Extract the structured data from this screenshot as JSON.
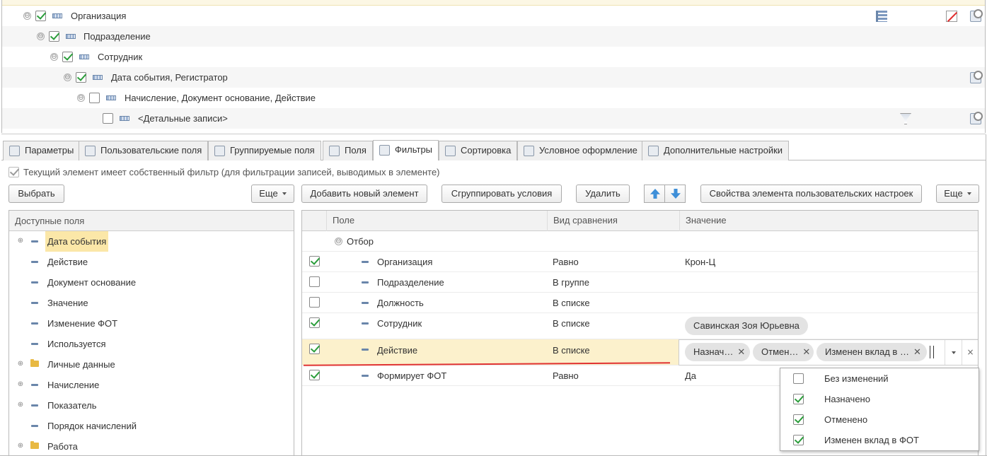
{
  "tree": {
    "rows": [
      {
        "label": "Организация",
        "checked": true
      },
      {
        "label": "Подразделение",
        "checked": true
      },
      {
        "label": "Сотрудник",
        "checked": true
      },
      {
        "label": "Дата события, Регистратор",
        "checked": true
      },
      {
        "label": "Начисление, Документ основание, Действие",
        "checked": false
      },
      {
        "label": "<Детальные записи>",
        "checked": false
      }
    ]
  },
  "tabs": [
    {
      "label": "Параметры"
    },
    {
      "label": "Пользовательские поля"
    },
    {
      "label": "Группируемые поля"
    },
    {
      "label": "Поля"
    },
    {
      "label": "Фильтры"
    },
    {
      "label": "Сортировка"
    },
    {
      "label": "Условное оформление"
    },
    {
      "label": "Дополнительные настройки"
    }
  ],
  "own_filter": {
    "label": "Текущий элемент имеет собственный фильтр (для фильтрации записей, выводимых в элементе)",
    "checked": true
  },
  "left_toolbar": {
    "select": "Выбрать",
    "more": "Еще"
  },
  "right_toolbar": {
    "add": "Добавить новый элемент",
    "group": "Сгруппировать условия",
    "delete": "Удалить",
    "properties": "Свойства элемента пользовательских настроек",
    "more": "Еще"
  },
  "available_fields": {
    "header": "Доступные поля",
    "items": [
      {
        "label": "Дата события"
      },
      {
        "label": "Действие"
      },
      {
        "label": "Документ основание"
      },
      {
        "label": "Значение"
      },
      {
        "label": "Изменение ФОТ"
      },
      {
        "label": "Используется"
      },
      {
        "label": "Личные данные"
      },
      {
        "label": "Начисление"
      },
      {
        "label": "Показатель"
      },
      {
        "label": "Порядок начислений"
      },
      {
        "label": "Работа"
      }
    ]
  },
  "filter_grid": {
    "headers": {
      "field": "Поле",
      "comparison": "Вид сравнения",
      "value": "Значение"
    },
    "group_label": "Отбор",
    "rows": [
      {
        "field": "Организация",
        "comparison": "Равно",
        "value": "Крон-Ц",
        "checked": true
      },
      {
        "field": "Подразделение",
        "comparison": "В группе",
        "value": "",
        "checked": false
      },
      {
        "field": "Должность",
        "comparison": "В списке",
        "value": "",
        "checked": false
      },
      {
        "field": "Сотрудник",
        "comparison": "В списке",
        "chip": "Савинская Зоя Юрьевна",
        "checked": true
      },
      {
        "field": "Действие",
        "comparison": "В списке",
        "checked": true
      },
      {
        "field": "Формирует ФОТ",
        "comparison": "Равно",
        "value": "Да",
        "checked": true
      }
    ],
    "editor_chips": [
      {
        "label": "Назнач…"
      },
      {
        "label": "Отмен…"
      },
      {
        "label": "Изменен вклад в …"
      }
    ],
    "chip_close": "✕",
    "clear_glyph": "×"
  },
  "dropdown": {
    "items": [
      {
        "label": "Без изменений",
        "checked": false
      },
      {
        "label": "Назначено",
        "checked": true
      },
      {
        "label": "Отменено",
        "checked": true
      },
      {
        "label": "Изменен вклад в ФОТ",
        "checked": true
      }
    ]
  },
  "glyphs": {
    "collapse": "⊖",
    "expand": "⊕"
  }
}
